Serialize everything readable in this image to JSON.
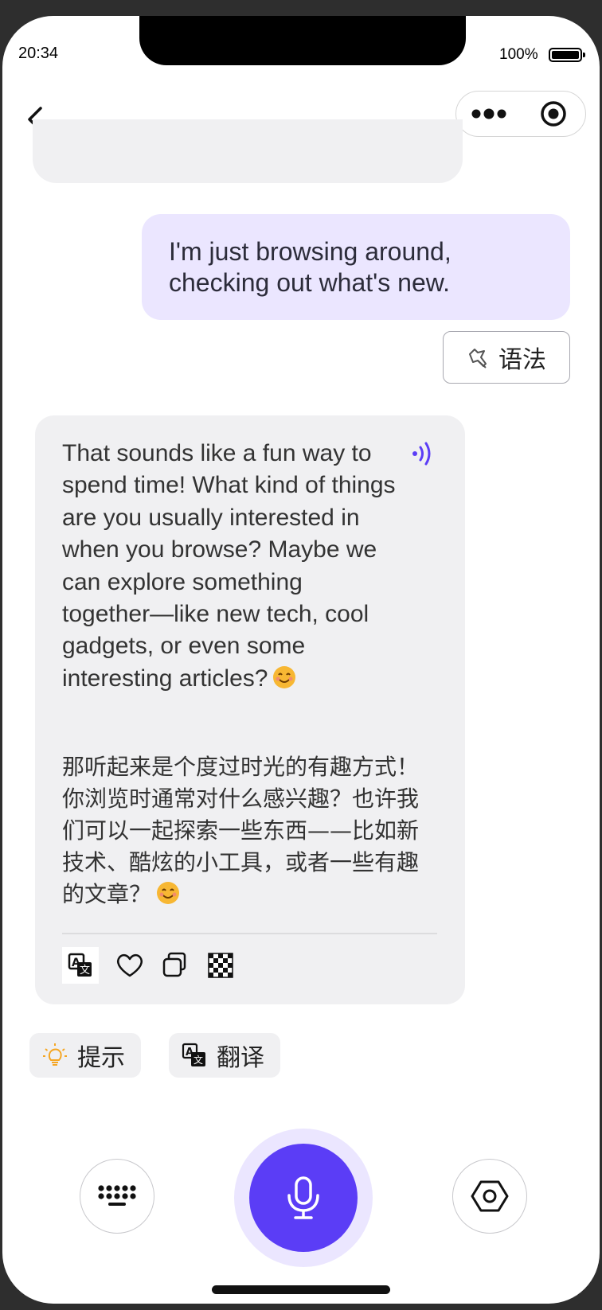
{
  "status_bar": {
    "time": "20:34",
    "battery": "100%"
  },
  "nav": {
    "back_icon": "chevron-left-icon",
    "more_icon": "more-dots-icon",
    "target_icon": "record-target-icon"
  },
  "conversation": {
    "user_message": "I'm just browsing around, checking out what's new.",
    "grammar_button": "语法",
    "bot_message_en": "That sounds like a fun way to spend time! What kind of things are you usually interested in when you browse? Maybe we can explore something together—like new tech, cool gadgets, or even some interesting articles?",
    "bot_message_zh": "那听起来是个度过时光的有趣方式！你浏览时通常对什么感兴趣？也许我们可以一起探索一些东西——比如新技术、酷炫的小工具，或者一些有趣的文章？",
    "emoji": "smiling-face-emoji"
  },
  "quick_actions": {
    "hint_label": "提示",
    "translate_label": "翻译"
  },
  "colors": {
    "accent": "#5b3df6",
    "user_bubble": "#ebe6ff",
    "bot_bubble": "#f0f0f2",
    "hint_icon": "#f5a623"
  }
}
